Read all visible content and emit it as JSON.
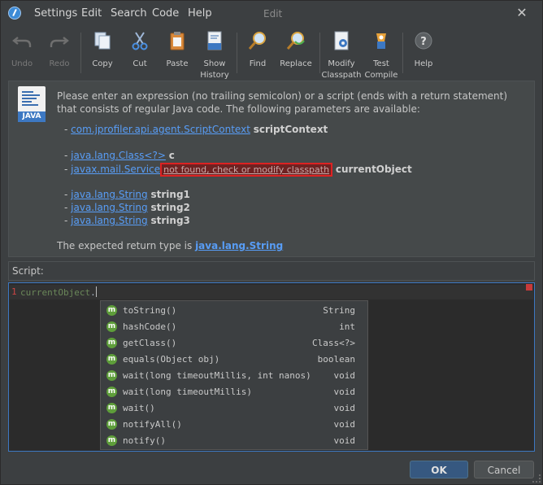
{
  "titlebar": {
    "menus": [
      "Settings",
      "Edit",
      "Search",
      "Code",
      "Help"
    ],
    "title": "Edit",
    "close": "✕"
  },
  "toolbar": {
    "undo": "Undo",
    "redo": "Redo",
    "copy": "Copy",
    "cut": "Cut",
    "paste": "Paste",
    "show_history_1": "Show",
    "show_history_2": "History",
    "find": "Find",
    "replace": "Replace",
    "modify_classpath_1": "Modify",
    "modify_classpath_2": "Classpath",
    "test_compile_1": "Test",
    "test_compile_2": "Compile",
    "help": "Help"
  },
  "info": {
    "icon_label": "JAVA",
    "description": "Please enter an expression (no trailing semicolon) or a script (ends with a return statement) that consists of regular Java code. The following parameters are available:",
    "params": [
      {
        "dash": "- ",
        "type": "com.jprofiler.api.agent.ScriptContext",
        "name": "scriptContext"
      },
      {
        "dash": "- ",
        "type": "java.lang.Class<?>",
        "name": "c"
      },
      {
        "dash": "- ",
        "type": "javax.mail.Service",
        "error": "not found, check or modify classpath",
        "name": "currentObject"
      },
      {
        "dash": "- ",
        "type": "java.lang.String",
        "name": "string1"
      },
      {
        "dash": "- ",
        "type": "java.lang.String",
        "name": "string2"
      },
      {
        "dash": "- ",
        "type": "java.lang.String",
        "name": "string3"
      }
    ],
    "return_prefix": "The expected return type is ",
    "return_type": "java.lang.String"
  },
  "script_label": "Script:",
  "editor": {
    "line_number": "1",
    "code": "currentObject",
    "dot": "."
  },
  "completion": [
    {
      "sig": "toString()",
      "ret": "String"
    },
    {
      "sig": "hashCode()",
      "ret": "int"
    },
    {
      "sig": "getClass()",
      "ret": "Class<?>"
    },
    {
      "sig": "equals(Object obj)",
      "ret": "boolean"
    },
    {
      "sig": "wait(long timeoutMillis, int nanos)",
      "ret": "void"
    },
    {
      "sig": "wait(long timeoutMillis)",
      "ret": "void"
    },
    {
      "sig": "wait()",
      "ret": "void"
    },
    {
      "sig": "notifyAll()",
      "ret": "void"
    },
    {
      "sig": "notify()",
      "ret": "void"
    }
  ],
  "completion_badge": "m",
  "buttons": {
    "ok": "OK",
    "cancel": "Cancel"
  },
  "colors": {
    "accent": "#3d78c2",
    "link": "#589df6",
    "error": "#dd2222",
    "method_badge": "#5e9e3a"
  }
}
